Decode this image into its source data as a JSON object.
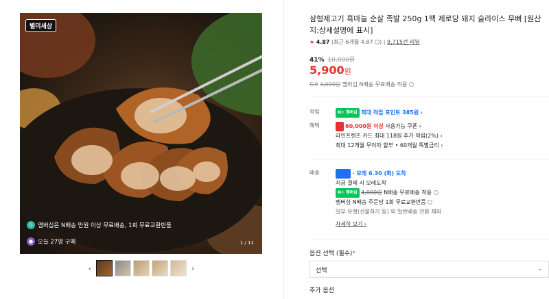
{
  "gallery": {
    "brand": "별미세상",
    "promo_line1": "멤버십은 N배송 만원 이상 무료배송, 1회 무료교환반품",
    "promo_line2": "오늘 27명 구매",
    "counter": "1 / 11",
    "prev_arrow": "‹",
    "next_arrow": "›",
    "thumbnails": [
      "thumb-1",
      "thumb-2",
      "thumb-3",
      "thumb-4",
      "thumb-5"
    ]
  },
  "product": {
    "title": "삼형제고기 흑마늘 순살 족발 250g 1팩 제로당 돼지 슬라이스 무뼈 [원산지:상세설명에 표시]",
    "rating": "4.87",
    "rating_detail": "(최근 6개월 4.87",
    "review_count": "9,715건 리뷰",
    "discount_pct": "41%",
    "original_price": "10,000원",
    "price": "5,900",
    "price_unit": "원",
    "member_label": "도9",
    "member_orig": "4,000원",
    "member_text": "멤버십 N배송 무료배송 적용"
  },
  "benefits": {
    "points_label": "적립",
    "points_badge": "N+ 멤버십",
    "points_text": "최대 적립 포인트 385원",
    "perks_label": "혜택",
    "coupon_badge": "쿠",
    "coupon_amount": "60,000원 이상",
    "coupon_text": "사용가능 쿠폰 ›",
    "card_text": "라인프렌즈 카드 최대 118원 추가 적립(2%) ›",
    "installment_text": "최대 12개월 무이자 할부 • 60개월 특별금리 ›"
  },
  "delivery": {
    "label": "배송",
    "badge": "N배송",
    "arrival": "· 모레 6.30 (화) 도착",
    "order_note": "지금 결제 시 모레도착",
    "member_badge": "N+ 멤버십",
    "orig_fee": "4,000원",
    "free_text": "N배송 무료배송 적용",
    "exchange_text": "멤버십 N배송 주문당 1회 무료교환반품",
    "exception_text": "일부 유형(선물하기 등) 외 일반배송 전환 제외",
    "details_link": "자세히 보기 ›"
  },
  "options": {
    "label": "옵션 선택 (필수)",
    "required_mark": "*",
    "select_value": "선택",
    "extra_label": "추가 옵션"
  }
}
